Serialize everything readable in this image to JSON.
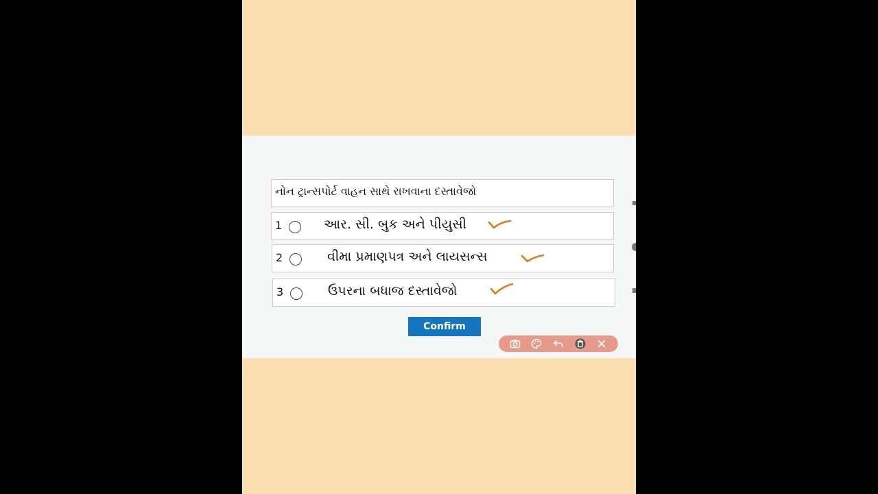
{
  "question": {
    "text": "નોન ટ્રાન્સપોર્ટ વાહન સાથે રાખવાના દસ્તાવેજો"
  },
  "options": [
    {
      "number": "1",
      "text": "આર. સી. બુક અને પીયુસી"
    },
    {
      "number": "2",
      "text": "વીમા પ્રમાણપત્ર અને લાયસન્સ"
    },
    {
      "number": "3",
      "text": "ઉપરના બધાજ દસ્તાવેજો"
    }
  ],
  "confirm_label": "Confirm",
  "toolbar": {
    "tools": [
      "camera-icon",
      "palette-icon",
      "undo-icon",
      "trash-icon",
      "close-icon"
    ]
  },
  "colors": {
    "page_background": "#fbdfb0",
    "panel_background": "#f4f7f5",
    "accent": "#1576c0",
    "check_mark": "#e07b1a",
    "toolbar": "#e89a8a"
  }
}
